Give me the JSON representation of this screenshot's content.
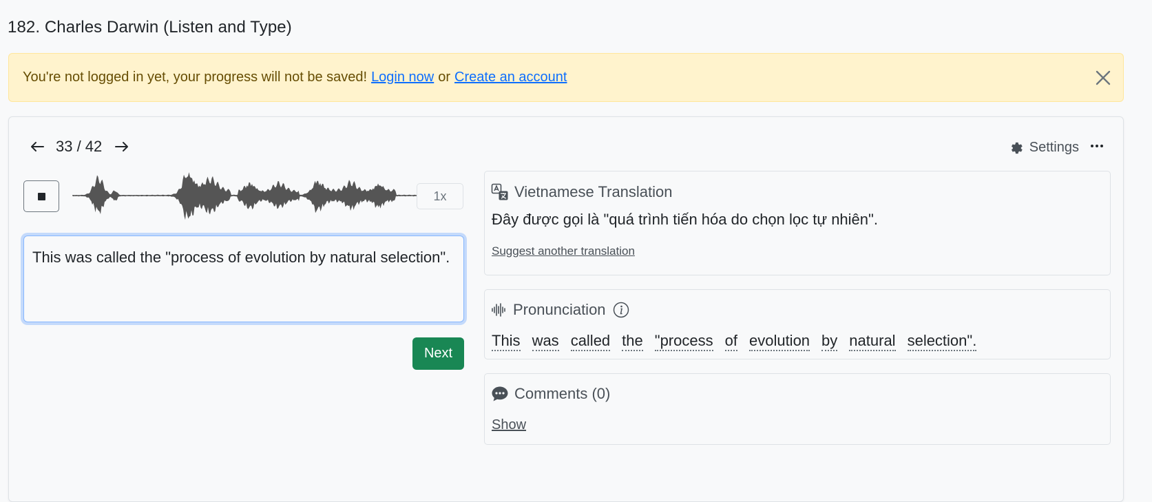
{
  "page": {
    "title": "182. Charles Darwin (Listen and Type)"
  },
  "alert": {
    "message": "You're not logged in yet, your progress will not be saved!",
    "login_link": "Login now",
    "separator": "or",
    "signup_link": "Create an account",
    "close_icon": "close-icon"
  },
  "exercise": {
    "counter": "33 / 42",
    "prev_icon": "arrow-left-icon",
    "next_icon": "arrow-right-icon",
    "settings_label": "Settings",
    "more_icon": "ellipsis-icon",
    "audio": {
      "stop_icon": "stop-icon",
      "speed_label": "1x"
    },
    "answer_value": "This was called the \"process of evolution by natural selection\".",
    "next_button": "Next"
  },
  "translation": {
    "heading": "Vietnamese Translation",
    "icon": "translate-icon",
    "text": "Đây được gọi là \"quá trình tiến hóa do chọn lọc tự nhiên\".",
    "suggest_link": "Suggest another translation"
  },
  "pronunciation": {
    "heading": "Pronunciation",
    "icon": "audio-waveform-icon",
    "info_icon": "info-icon",
    "words": [
      "This",
      "was",
      "called",
      "the",
      "\"process",
      "of",
      "evolution",
      "by",
      "natural",
      "selection\"."
    ]
  },
  "comments": {
    "heading": "Comments (0)",
    "icon": "chat-bubble-icon",
    "show_link": "Show"
  },
  "colors": {
    "alert_bg": "#fff3cd",
    "alert_text": "#664d03",
    "link": "#0d6efd",
    "next_button_bg": "#198754",
    "focus_border": "#86b7fe"
  }
}
